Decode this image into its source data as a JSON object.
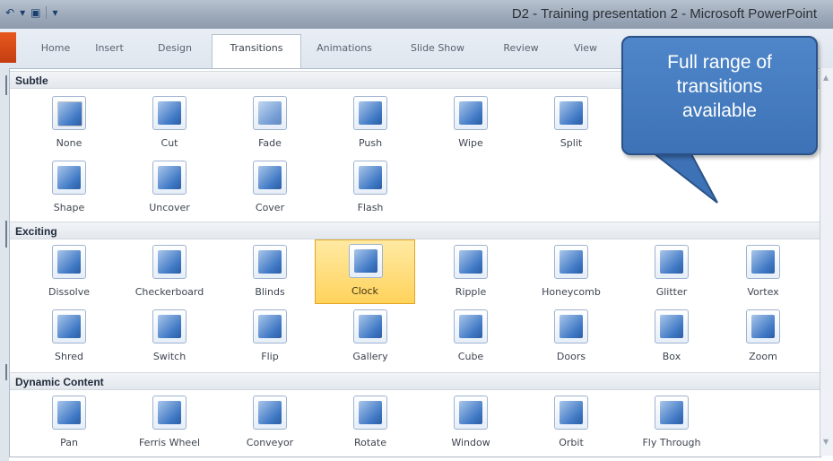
{
  "window": {
    "title": "D2 - Training presentation 2 - Microsoft PowerPoint"
  },
  "ribbon": {
    "tabs": [
      {
        "label": "Home"
      },
      {
        "label": "Insert"
      },
      {
        "label": "Design"
      },
      {
        "label": "Transitions",
        "active": true
      },
      {
        "label": "Animations"
      },
      {
        "label": "Slide Show"
      },
      {
        "label": "Review"
      },
      {
        "label": "View"
      }
    ]
  },
  "gallery": {
    "sections": [
      {
        "header": "Subtle",
        "items": [
          {
            "label": "None",
            "icon": "none-transition-icon"
          },
          {
            "label": "Cut",
            "icon": "cut-transition-icon"
          },
          {
            "label": "Fade",
            "icon": "fade-transition-icon"
          },
          {
            "label": "Push",
            "icon": "push-transition-icon"
          },
          {
            "label": "Wipe",
            "icon": "wipe-transition-icon"
          },
          {
            "label": "Split",
            "icon": "split-transition-icon"
          },
          {
            "label": "Shape",
            "icon": "shape-transition-icon"
          },
          {
            "label": "Uncover",
            "icon": "uncover-transition-icon"
          },
          {
            "label": "Cover",
            "icon": "cover-transition-icon"
          },
          {
            "label": "Flash",
            "icon": "flash-transition-icon"
          }
        ]
      },
      {
        "header": "Exciting",
        "items": [
          {
            "label": "Dissolve",
            "icon": "dissolve-transition-icon"
          },
          {
            "label": "Checkerboard",
            "icon": "checkerboard-transition-icon"
          },
          {
            "label": "Blinds",
            "icon": "blinds-transition-icon"
          },
          {
            "label": "Clock",
            "icon": "clock-transition-icon",
            "selected": true
          },
          {
            "label": "Ripple",
            "icon": "ripple-transition-icon"
          },
          {
            "label": "Honeycomb",
            "icon": "honeycomb-transition-icon"
          },
          {
            "label": "Glitter",
            "icon": "glitter-transition-icon"
          },
          {
            "label": "Vortex",
            "icon": "vortex-transition-icon"
          },
          {
            "label": "Shred",
            "icon": "shred-transition-icon"
          },
          {
            "label": "Switch",
            "icon": "switch-transition-icon"
          },
          {
            "label": "Flip",
            "icon": "flip-transition-icon"
          },
          {
            "label": "Gallery",
            "icon": "gallery-transition-icon"
          },
          {
            "label": "Cube",
            "icon": "cube-transition-icon"
          },
          {
            "label": "Doors",
            "icon": "doors-transition-icon"
          },
          {
            "label": "Box",
            "icon": "box-transition-icon"
          },
          {
            "label": "Zoom",
            "icon": "zoom-transition-icon"
          }
        ]
      },
      {
        "header": "Dynamic Content",
        "items": [
          {
            "label": "Pan",
            "icon": "pan-transition-icon"
          },
          {
            "label": "Ferris Wheel",
            "icon": "ferris-wheel-transition-icon"
          },
          {
            "label": "Conveyor",
            "icon": "conveyor-transition-icon"
          },
          {
            "label": "Rotate",
            "icon": "rotate-transition-icon"
          },
          {
            "label": "Window",
            "icon": "window-transition-icon"
          },
          {
            "label": "Orbit",
            "icon": "orbit-transition-icon"
          },
          {
            "label": "Fly Through",
            "icon": "fly-through-transition-icon"
          }
        ]
      }
    ]
  },
  "callout": {
    "text": "Full range of\ntransitions\navailable"
  },
  "colors": {
    "selected_bg": "#ffd35c",
    "callout_fill": "#4a80c4",
    "file_tab": "#d94a18"
  }
}
